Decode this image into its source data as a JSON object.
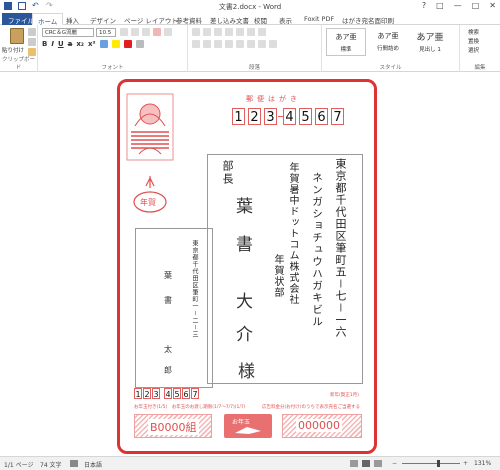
{
  "window": {
    "title": "文書2.docx - Word",
    "controls": [
      "?",
      "□",
      "—",
      "□",
      "✕"
    ]
  },
  "tabs": [
    "ファイル",
    "ホーム",
    "挿入",
    "デザイン",
    "ページ レイアウト",
    "参考資料",
    "差し込み文書",
    "校閲",
    "表示",
    "Foxit PDF",
    "はがき宛名面印刷"
  ],
  "ribbon": {
    "clipboard": {
      "paste": "貼り付け",
      "label": "クリップボード"
    },
    "font": {
      "name": "CRC＆G流麗",
      "size": "10.5",
      "label": "フォント"
    },
    "paragraph": {
      "label": "段落"
    },
    "styles": {
      "items": [
        {
          "preview": "あア亜",
          "name": "標準"
        },
        {
          "preview": "あア亜",
          "name": "行間詰め"
        },
        {
          "preview": "あア亜",
          "name": "見出し 1"
        }
      ],
      "label": "スタイル"
    },
    "editing": {
      "find": "検索",
      "replace": "置換",
      "select": "選択",
      "label": "編集"
    }
  },
  "postcard": {
    "header": "郵便はがき",
    "nenga": "年賀",
    "postal_digits": [
      "1",
      "2",
      "3",
      "4",
      "5",
      "6",
      "7"
    ],
    "address_line1": "東京都千代田区筆町五－七－一六",
    "address_line2": "ネンガショチュウハガキビル",
    "company1": "年賀暑中ドットコム株式会社",
    "dept": "年賀状部",
    "title_role": "部長",
    "recipient": [
      "葉",
      "書",
      "大",
      "介"
    ],
    "honorific": "様",
    "sender_address": "東京都千代田区筆町一－二－三",
    "sender_name": [
      "葉",
      "書",
      "太",
      "郎"
    ],
    "sender_postal": [
      "1",
      "2",
      "3",
      "4",
      "5",
      "6",
      "7"
    ],
    "footer_note_left": "お年玉付き(1/5)　お年玉のお渡し期限(1/7～7/7)(1/7)",
    "footer_note_right": "広告料金分(お付け)のうちで表示売名ご当選する",
    "corner_note": "新年(賀正1月)",
    "lot_left": "B0000組",
    "lot_right": "000000",
    "lot_badge": "お年玉"
  },
  "status": {
    "page": "1/1 ページ",
    "words": "74 文字",
    "lang": "日本語",
    "zoom": "131%"
  },
  "colors": {
    "accent": "#2b579a",
    "postcard_red": "#e05050",
    "frame_red": "#dd3333"
  }
}
